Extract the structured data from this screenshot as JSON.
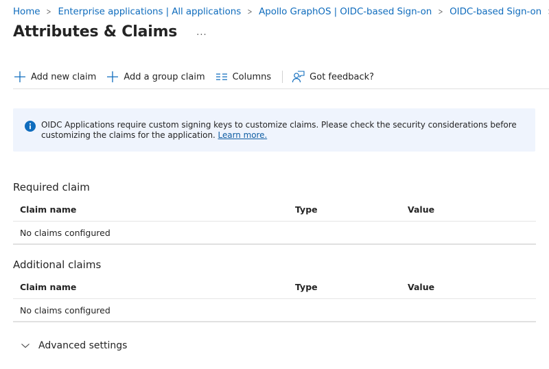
{
  "breadcrumb": [
    {
      "label": "Home"
    },
    {
      "label": "Enterprise applications | All applications"
    },
    {
      "label": "Apollo GraphOS | OIDC-based Sign-on"
    },
    {
      "label": "OIDC-based Sign-on"
    }
  ],
  "breadcrumb_separator": ">",
  "header": {
    "title": "Attributes & Claims",
    "more_label": "..."
  },
  "toolbar": {
    "add_new_claim": "Add new claim",
    "add_group_claim": "Add a group claim",
    "columns": "Columns",
    "feedback": "Got feedback?"
  },
  "info_banner": {
    "message": "OIDC Applications require custom signing keys to customize claims. Please check the security considerations before customizing the claims for the application.",
    "link": "Learn more."
  },
  "required_claim": {
    "title": "Required claim",
    "columns": [
      "Claim name",
      "Type",
      "Value"
    ],
    "empty_text": "No claims configured"
  },
  "additional_claims": {
    "title": "Additional claims",
    "columns": [
      "Claim name",
      "Type",
      "Value"
    ],
    "empty_text": "No claims configured"
  },
  "advanced_settings": {
    "label": "Advanced settings",
    "expanded": false
  },
  "colors": {
    "link": "#0f6cbd",
    "banner_bg": "#eff4fd",
    "info_icon": "#0f6cbd"
  }
}
